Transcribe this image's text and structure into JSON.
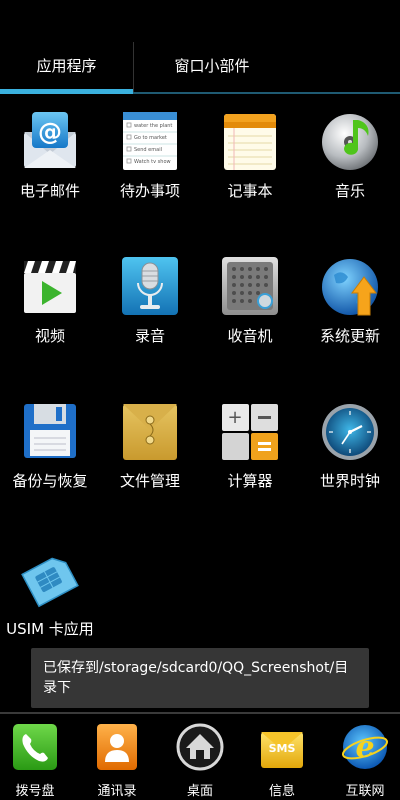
{
  "tabs": [
    {
      "label": "应用程序"
    },
    {
      "label": "窗口小部件"
    }
  ],
  "apps": [
    {
      "label": "电子邮件",
      "icon": "email-icon"
    },
    {
      "label": "待办事项",
      "icon": "todo-icon"
    },
    {
      "label": "记事本",
      "icon": "notepad-icon"
    },
    {
      "label": "音乐",
      "icon": "music-icon"
    },
    {
      "label": "视频",
      "icon": "video-icon"
    },
    {
      "label": "录音",
      "icon": "recorder-icon"
    },
    {
      "label": "收音机",
      "icon": "radio-icon"
    },
    {
      "label": "系统更新",
      "icon": "update-icon"
    },
    {
      "label": "备份与恢复",
      "icon": "backup-icon"
    },
    {
      "label": "文件管理",
      "icon": "file-manager-icon"
    },
    {
      "label": "计算器",
      "icon": "calculator-icon"
    },
    {
      "label": "世界时钟",
      "icon": "clock-icon"
    },
    {
      "label": "USIM 卡应用",
      "icon": "sim-card-icon"
    }
  ],
  "todo_items": [
    "water the plant",
    "Go to market",
    "Send email",
    "Watch tv show"
  ],
  "toast": {
    "text": "已保存到/storage/sdcard0/QQ_Screenshot/目录下"
  },
  "dock": [
    {
      "label": "拨号盘",
      "icon": "phone-icon"
    },
    {
      "label": "通讯录",
      "icon": "contacts-icon"
    },
    {
      "label": "桌面",
      "icon": "home-icon"
    },
    {
      "label": "信息",
      "icon": "sms-icon"
    },
    {
      "label": "互联网",
      "icon": "browser-icon"
    }
  ],
  "sms_icon_text": "SMS",
  "colors": {
    "tab_indicator": "#3ab1de",
    "toast_bg": "#363636",
    "background": "#000000"
  }
}
